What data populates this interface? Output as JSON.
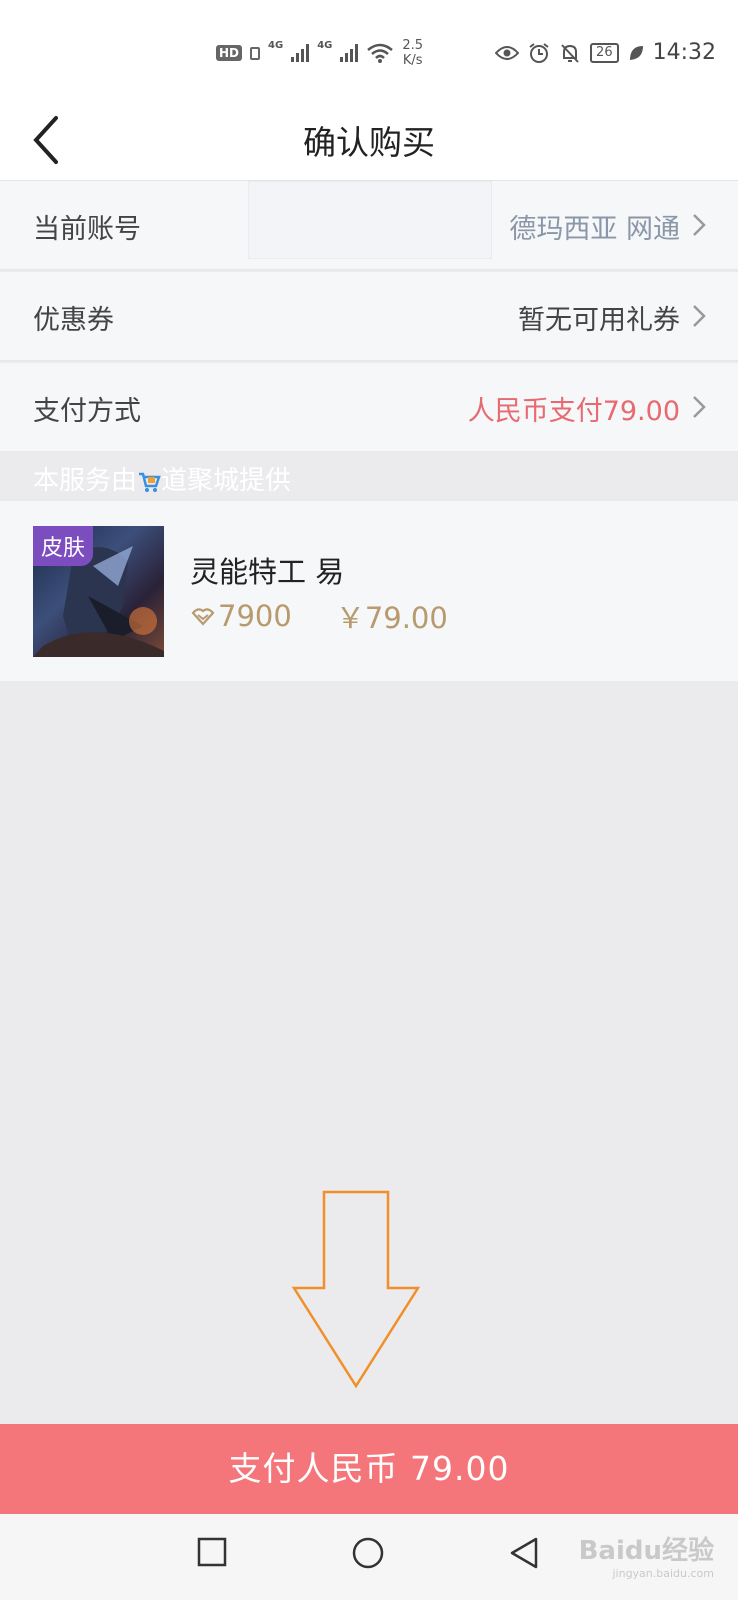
{
  "status_bar": {
    "hd": "HD",
    "net1": "4G",
    "net2": "4G",
    "speed_value": "2.5",
    "speed_unit": "K/s",
    "battery": "26",
    "time": "14:32",
    "icons": [
      "eye-icon",
      "alarm-icon",
      "bell-off-icon",
      "leaf-icon",
      "wifi-icon",
      "signal-icon"
    ]
  },
  "header": {
    "title": "确认购买",
    "back_icon": "chevron-left-icon"
  },
  "rows": {
    "account": {
      "label": "当前账号",
      "value": "德玛西亚 网通"
    },
    "coupon": {
      "label": "优惠券",
      "value": "暂无可用礼券"
    },
    "payment": {
      "label": "支付方式",
      "value": "人民币支付79.00"
    }
  },
  "provider": {
    "text_before": "本服务由",
    "text_after": "道聚城提供",
    "icon": "cart-icon"
  },
  "product": {
    "tag": "皮肤",
    "name": "灵能特工 易",
    "points": "7900",
    "price": "￥79.00",
    "points_icon": "coupon-icon"
  },
  "pay_button": {
    "label": "支付人民币 79.00"
  },
  "watermark": {
    "brand": "Baidu经验",
    "url": "jingyan.baidu.com"
  },
  "colors": {
    "accent_red": "#f5767a",
    "payment_red": "#e66a6f",
    "price_gold": "#b79a6e",
    "tag_purple": "#7c4dbe",
    "arrow_orange": "#f0902a"
  }
}
